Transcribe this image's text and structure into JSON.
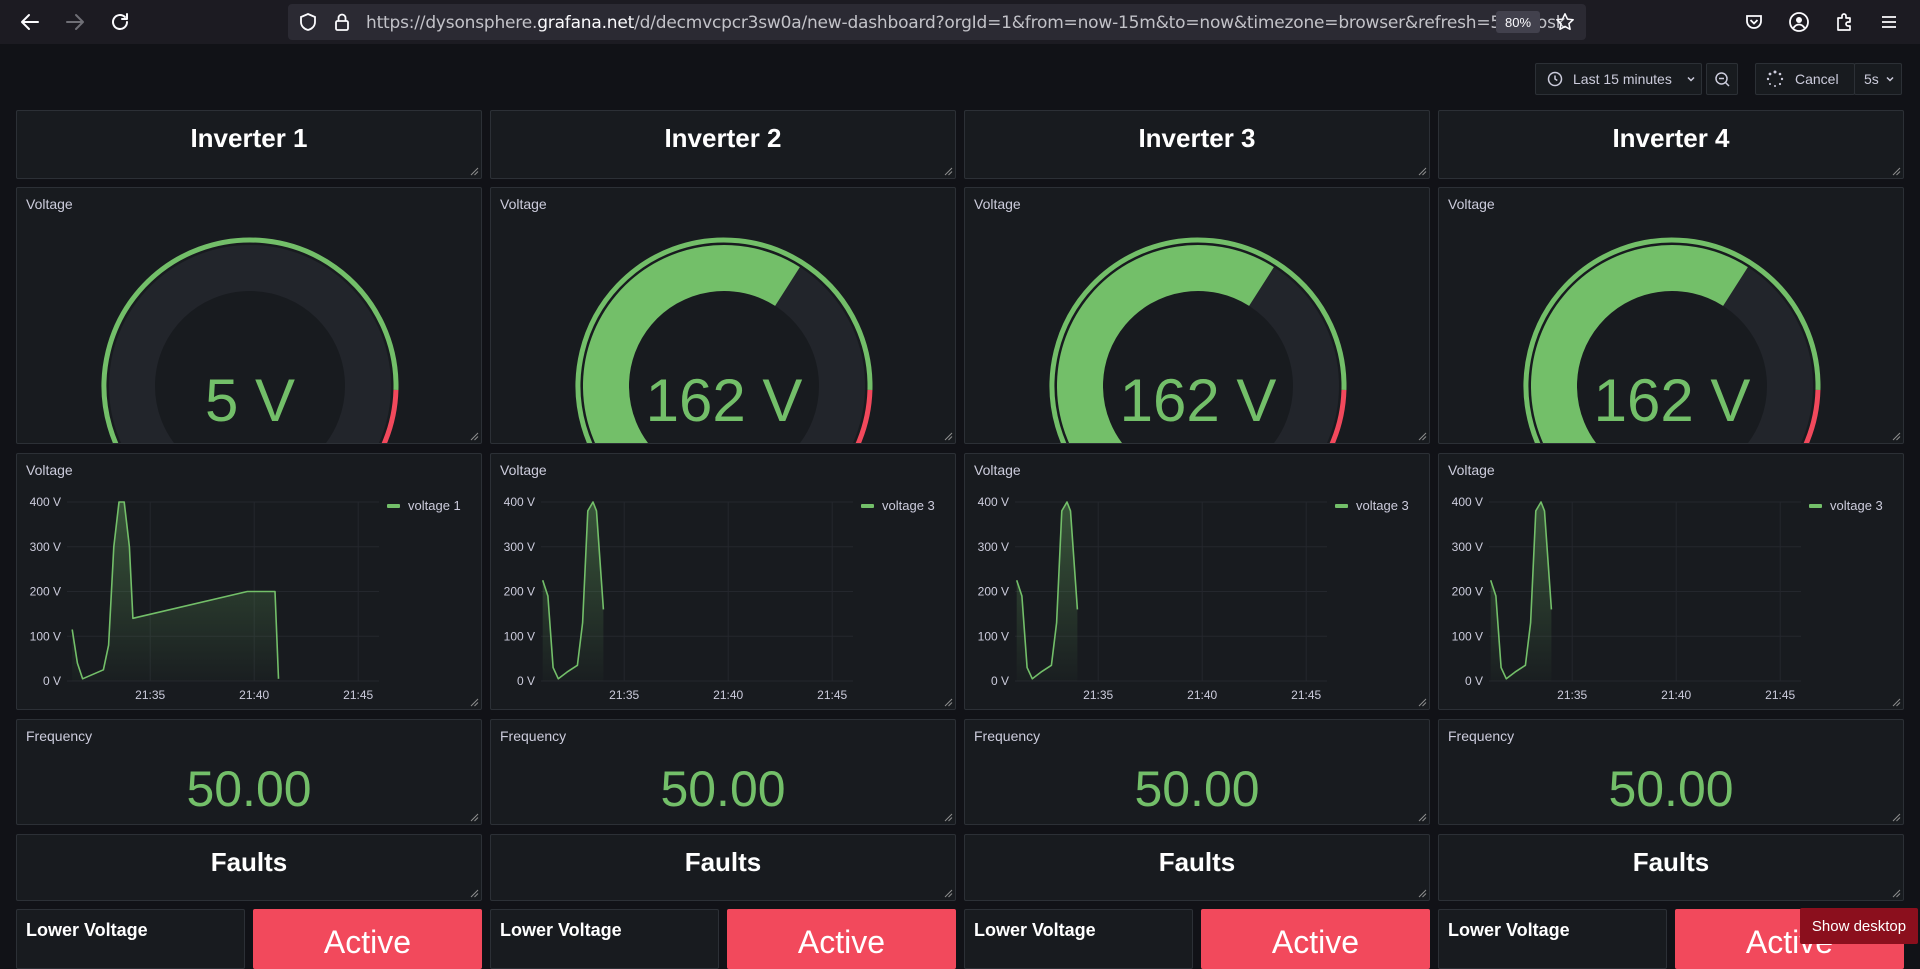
{
  "browser": {
    "url_prefix": "https://dysonsphere.",
    "url_domain": "grafana.net",
    "url_suffix": "/d/decmvcpcr3sw0a/new-dashboard?orgId=1&from=now-15m&to=now&timezone=browser&refresh=5s&kiosk",
    "zoom": "80%"
  },
  "toolbar": {
    "time_range": "Last 15 minutes",
    "cancel_label": "Cancel",
    "refresh_interval": "5s"
  },
  "colors": {
    "green": "#73bf69",
    "red": "#f2495c",
    "bg": "#111217",
    "panel": "#181b1f"
  },
  "gauge": {
    "min": 0,
    "max": 260,
    "threshold": 220
  },
  "chart_axis": {
    "y_ticks": [
      "400 V",
      "300 V",
      "200 V",
      "100 V",
      "0 V"
    ],
    "x_ticks": [
      "21:35",
      "21:40",
      "21:45"
    ]
  },
  "columns": [
    {
      "title": "Inverter 1",
      "voltage_title": "Voltage",
      "gauge_value": 5,
      "gauge_text": "5 V",
      "chart_title": "Voltage",
      "chart_data": {
        "type": "area",
        "ylabel": "",
        "ylim": [
          0,
          400
        ],
        "x_range": [
          "21:31:00",
          "21:46:00"
        ],
        "series": [
          {
            "name": "voltage 1",
            "points": [
              [
                "21:31:15",
                115
              ],
              [
                "21:31:30",
                40
              ],
              [
                "21:31:45",
                5
              ],
              [
                "21:32:15",
                15
              ],
              [
                "21:32:45",
                25
              ],
              [
                "21:33:00",
                80
              ],
              [
                "21:33:15",
                300
              ],
              [
                "21:33:30",
                400
              ],
              [
                "21:33:45",
                400
              ],
              [
                "21:34:00",
                300
              ],
              [
                "21:34:10",
                140
              ],
              [
                "21:39:40",
                200
              ],
              [
                "21:41:00",
                200
              ],
              [
                "21:41:10",
                5
              ]
            ]
          }
        ]
      },
      "freq_title": "Frequency",
      "freq_value": "50.00",
      "faults_title": "Faults",
      "lv_title": "Lower Voltage",
      "status": "Active"
    },
    {
      "title": "Inverter 2",
      "voltage_title": "Voltage",
      "gauge_value": 162,
      "gauge_text": "162 V",
      "chart_title": "Voltage",
      "chart_data": {
        "type": "area",
        "ylabel": "",
        "ylim": [
          0,
          400
        ],
        "x_range": [
          "21:31:00",
          "21:46:00"
        ],
        "series": [
          {
            "name": "voltage 3",
            "points": [
              [
                "21:31:05",
                225
              ],
              [
                "21:31:20",
                190
              ],
              [
                "21:31:35",
                30
              ],
              [
                "21:31:50",
                5
              ],
              [
                "21:32:15",
                20
              ],
              [
                "21:32:45",
                35
              ],
              [
                "21:33:00",
                130
              ],
              [
                "21:33:15",
                380
              ],
              [
                "21:33:30",
                400
              ],
              [
                "21:33:40",
                380
              ],
              [
                "21:34:00",
                160
              ]
            ]
          }
        ]
      },
      "freq_title": "Frequency",
      "freq_value": "50.00",
      "faults_title": "Faults",
      "lv_title": "Lower Voltage",
      "status": "Active"
    },
    {
      "title": "Inverter 3",
      "voltage_title": "Voltage",
      "gauge_value": 162,
      "gauge_text": "162 V",
      "chart_title": "Voltage",
      "chart_data": {
        "type": "area",
        "ylabel": "",
        "ylim": [
          0,
          400
        ],
        "x_range": [
          "21:31:00",
          "21:46:00"
        ],
        "series": [
          {
            "name": "voltage 3",
            "points": [
              [
                "21:31:05",
                225
              ],
              [
                "21:31:20",
                190
              ],
              [
                "21:31:35",
                30
              ],
              [
                "21:31:50",
                5
              ],
              [
                "21:32:15",
                20
              ],
              [
                "21:32:45",
                35
              ],
              [
                "21:33:00",
                130
              ],
              [
                "21:33:15",
                380
              ],
              [
                "21:33:30",
                400
              ],
              [
                "21:33:40",
                380
              ],
              [
                "21:34:00",
                160
              ]
            ]
          }
        ]
      },
      "freq_title": "Frequency",
      "freq_value": "50.00",
      "faults_title": "Faults",
      "lv_title": "Lower Voltage",
      "status": "Active"
    },
    {
      "title": "Inverter 4",
      "voltage_title": "Voltage",
      "gauge_value": 162,
      "gauge_text": "162 V",
      "chart_title": "Voltage",
      "chart_data": {
        "type": "area",
        "ylabel": "",
        "ylim": [
          0,
          400
        ],
        "x_range": [
          "21:31:00",
          "21:46:00"
        ],
        "series": [
          {
            "name": "voltage 3",
            "points": [
              [
                "21:31:05",
                225
              ],
              [
                "21:31:20",
                190
              ],
              [
                "21:31:35",
                30
              ],
              [
                "21:31:50",
                5
              ],
              [
                "21:32:15",
                20
              ],
              [
                "21:32:45",
                35
              ],
              [
                "21:33:00",
                130
              ],
              [
                "21:33:15",
                380
              ],
              [
                "21:33:30",
                400
              ],
              [
                "21:33:40",
                380
              ],
              [
                "21:34:00",
                160
              ]
            ]
          }
        ]
      },
      "freq_title": "Frequency",
      "freq_value": "50.00",
      "faults_title": "Faults",
      "lv_title": "Lower Voltage",
      "status": "Active"
    }
  ],
  "taskbar": {
    "show_desktop": "Show desktop"
  }
}
